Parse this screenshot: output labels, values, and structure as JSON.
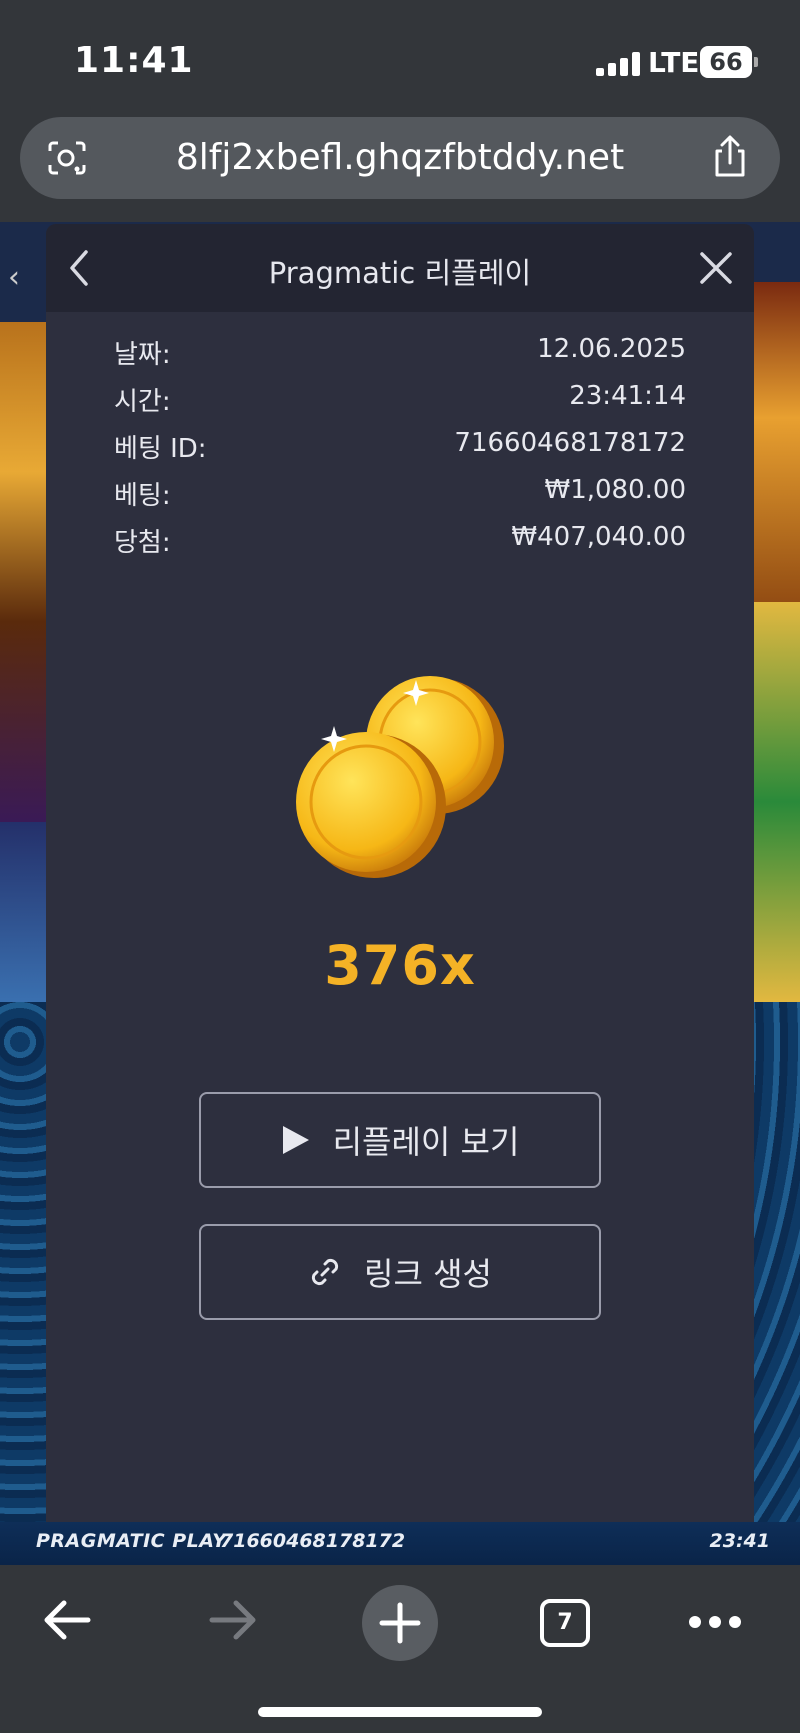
{
  "status_bar": {
    "time": "11:41",
    "network": "LTE",
    "battery": "66"
  },
  "browser": {
    "url": "8lfj2xbefl.ghqzfbtddy.net",
    "tab_count": "7"
  },
  "modal": {
    "title": "Pragmatic 리플레이",
    "details": [
      {
        "label": "날짜:",
        "value": "12.06.2025"
      },
      {
        "label": "시간:",
        "value": "23:41:14"
      },
      {
        "label": "베팅 ID:",
        "value": "71660468178172"
      },
      {
        "label": "베팅:",
        "value": "₩1,080.00"
      },
      {
        "label": "당첨:",
        "value": "₩407,040.00"
      }
    ],
    "multiplier": "376x",
    "replay_button": "리플레이 보기",
    "link_button": "링크 생성"
  },
  "game_strip": {
    "brand": "PRAGMATIC PLAY",
    "bet_id": "71660468178172",
    "time": "23:41"
  },
  "colors": {
    "modal_bg": "#2d2f3e",
    "header_bg": "#232532",
    "gold": "#f4b226"
  }
}
